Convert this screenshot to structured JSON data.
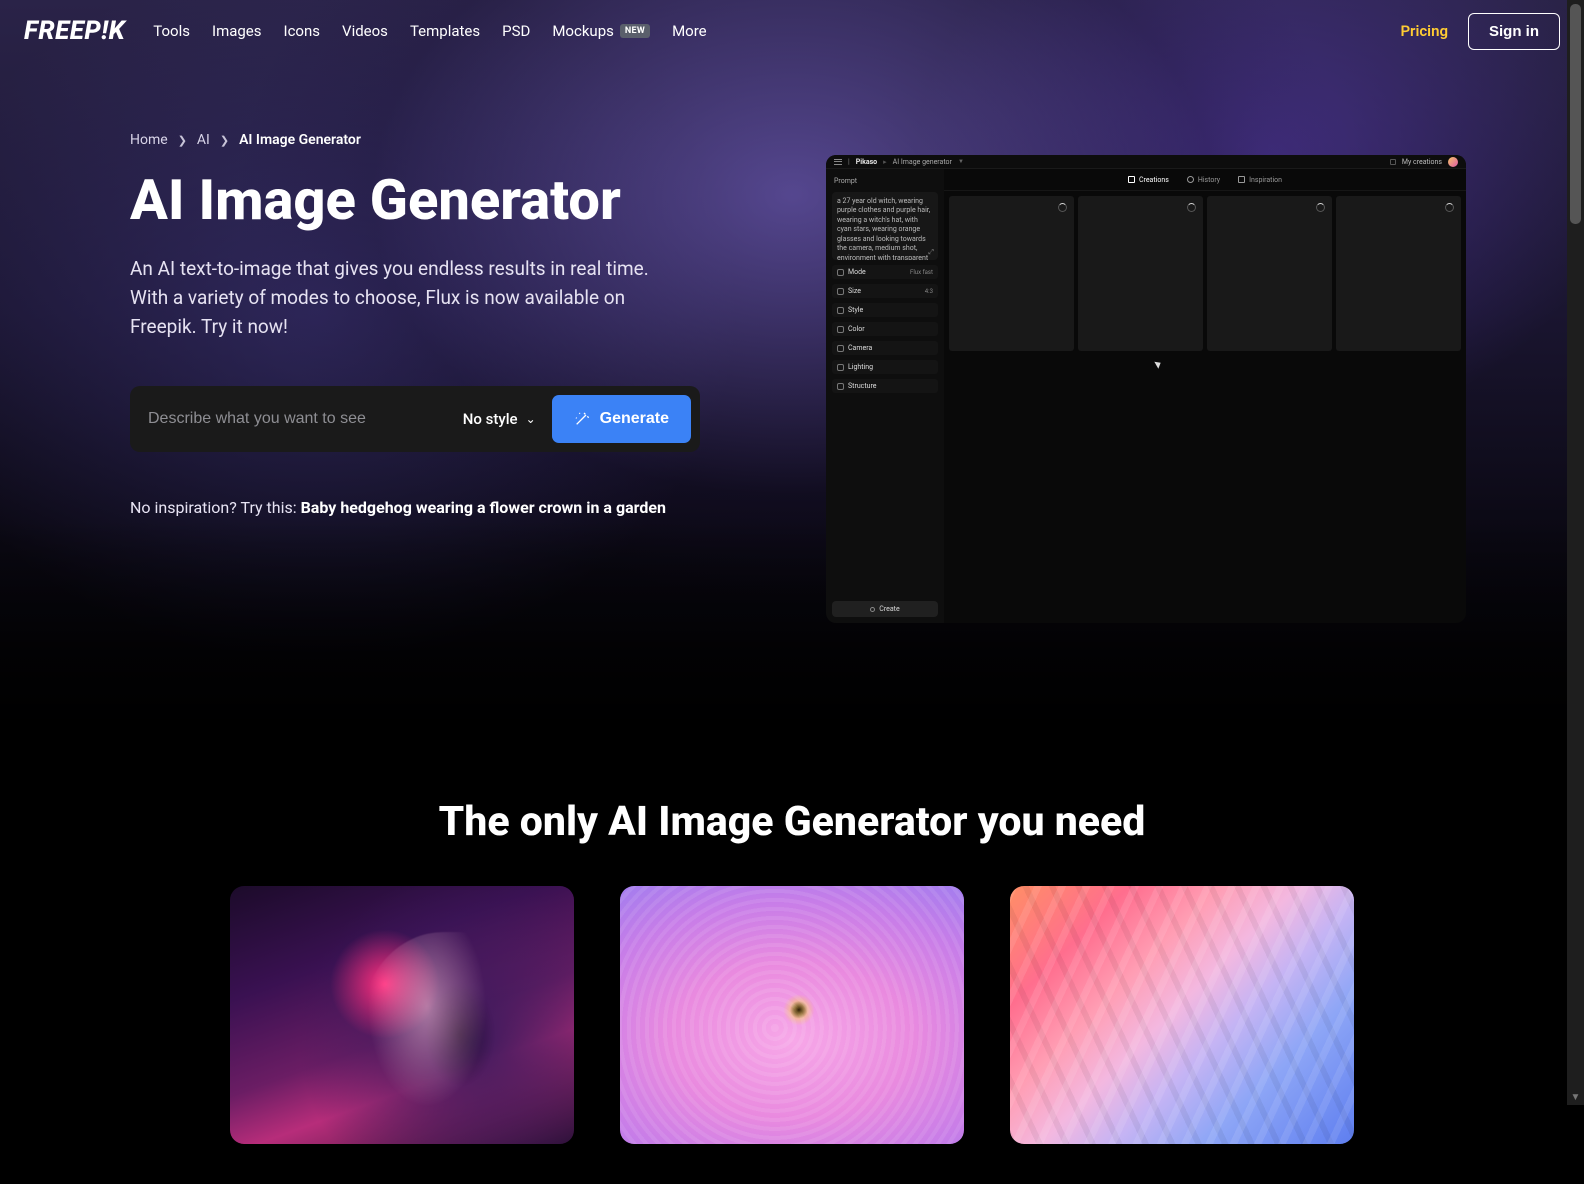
{
  "nav": {
    "logo": "FREEP!K",
    "links": [
      "Tools",
      "Images",
      "Icons",
      "Videos",
      "Templates",
      "PSD"
    ],
    "mockups_label": "Mockups",
    "mockups_badge": "NEW",
    "more": "More",
    "pricing": "Pricing",
    "signin": "Sign in"
  },
  "breadcrumb": {
    "items": [
      "Home",
      "AI"
    ],
    "current": "AI Image Generator"
  },
  "hero": {
    "title": "AI Image Generator",
    "subtitle": "An AI text-to-image that gives you endless results in real time. With a variety of modes to choose, Flux is now available on Freepik. Try it now!",
    "placeholder": "Describe what you want to see",
    "style_label": "No style",
    "generate": "Generate",
    "suggestion_lead": "No inspiration? Try this: ",
    "suggestion_text": "Baby hedgehog wearing a flower crown in a garden"
  },
  "app": {
    "brand": "Pikaso",
    "crumb": "AI Image generator",
    "my_creations": "My creations",
    "side": {
      "prompt_label": "Prompt",
      "prompt_text": "a 27 year old witch, wearing purple clothes and purple hair, wearing a witch's hat, with cyan stars, wearing orange glasses and looking towards the camera, medium shot, environment with transparent gray haze, high fidelity",
      "rows": [
        {
          "label": "Mode",
          "value": "Flux fast"
        },
        {
          "label": "Size",
          "value": "4:3"
        },
        {
          "label": "Style",
          "value": ""
        },
        {
          "label": "Color",
          "value": ""
        },
        {
          "label": "Camera",
          "value": ""
        },
        {
          "label": "Lighting",
          "value": ""
        },
        {
          "label": "Structure",
          "value": ""
        }
      ],
      "create": "Create"
    },
    "tabs": [
      "Creations",
      "History",
      "Inspiration"
    ]
  },
  "section2": {
    "title": "The only AI Image Generator you need"
  }
}
